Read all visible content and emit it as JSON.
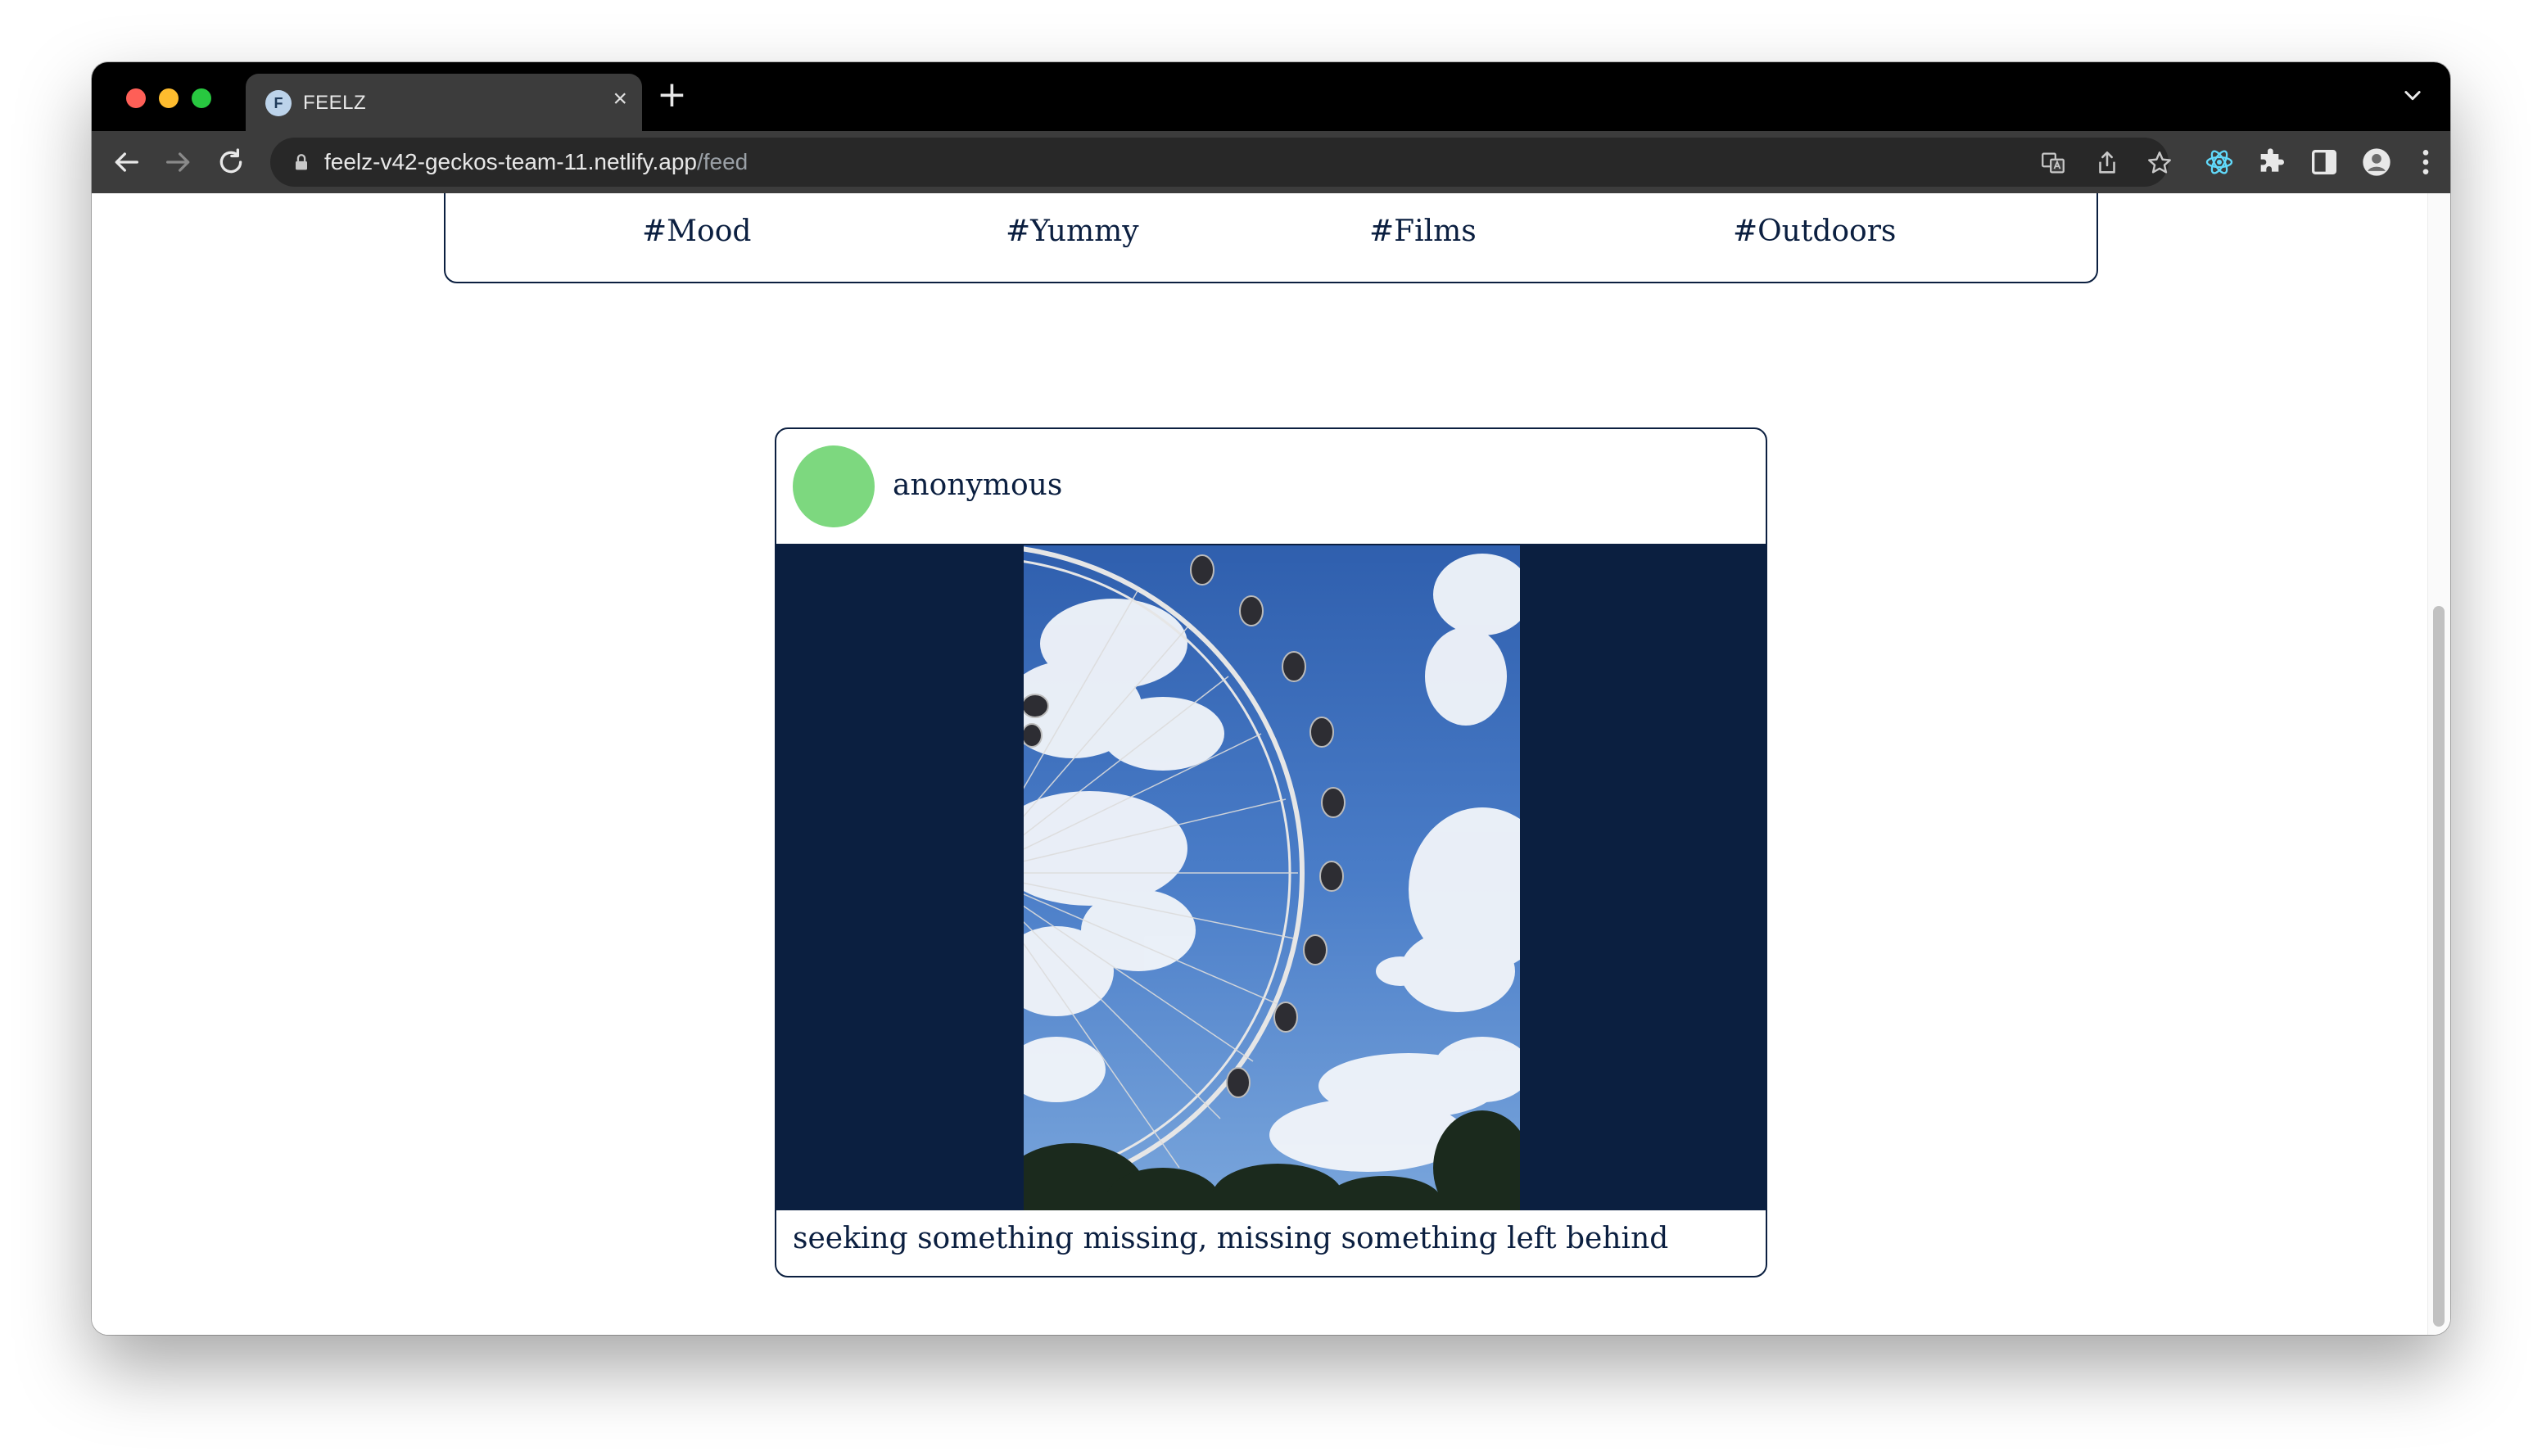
{
  "browser": {
    "tab_title": "FEELZ",
    "favicon_letter": "F",
    "tab_close": "×",
    "new_tab": "+",
    "url_host": "feelz-v42-geckos-team-11.netlify.app",
    "url_path": "/feed"
  },
  "tags": {
    "items": [
      {
        "label": "#Mood"
      },
      {
        "label": "#Yummy"
      },
      {
        "label": "#Films"
      },
      {
        "label": "#Outdoors"
      }
    ]
  },
  "post": {
    "username": "anonymous",
    "caption": "seeking something missing, missing something left behind",
    "image_subject": "ferris wheel against blue sky with clouds"
  },
  "colors": {
    "navy": "#0b1f40",
    "avatar": "#7dd87f",
    "chrome_dark": "#3c3c3c"
  }
}
